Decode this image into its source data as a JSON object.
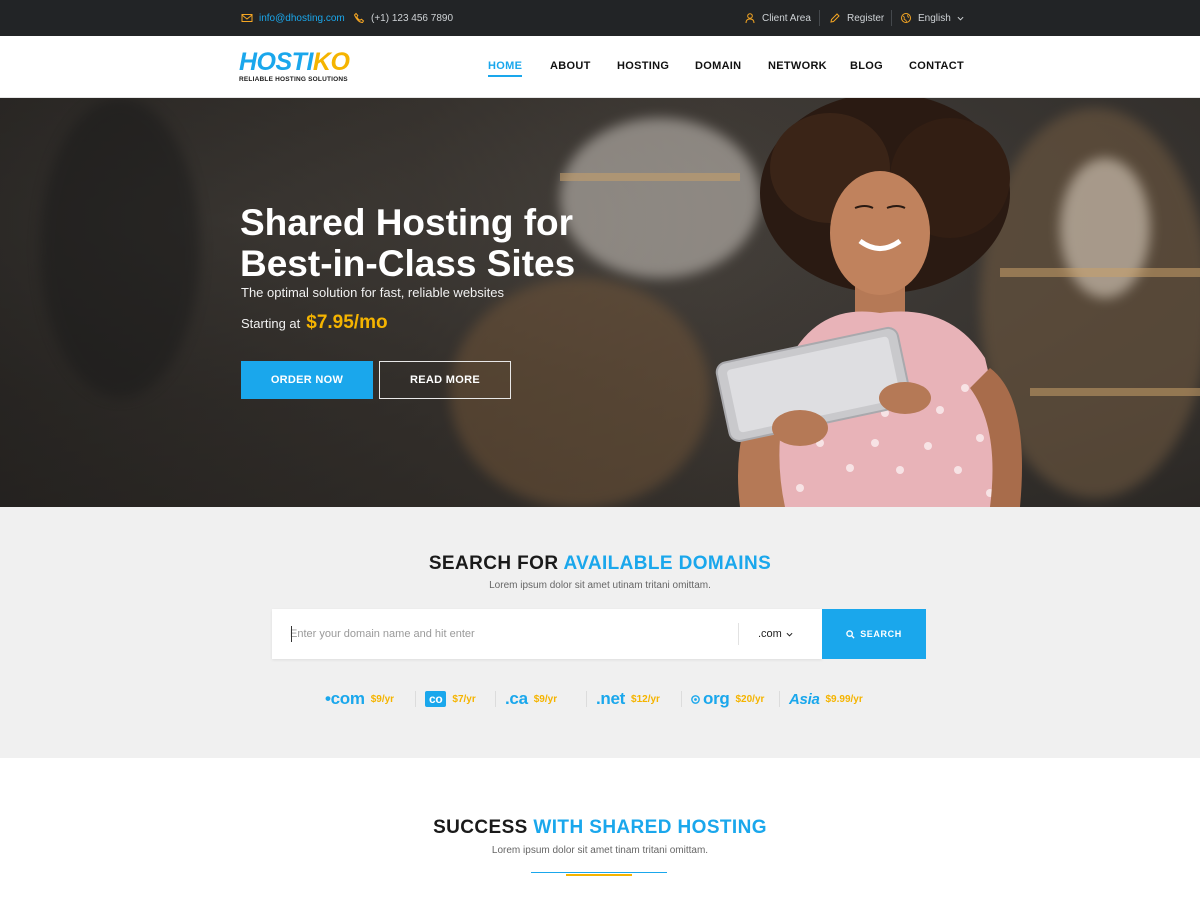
{
  "topbar": {
    "email": "info@dhosting.com",
    "phone": "(+1) 123 456 7890",
    "client_area": "Client Area",
    "register": "Register",
    "language": "English"
  },
  "header": {
    "logo_part1": "HOSTI",
    "logo_part2": "KO",
    "logo_tagline": "RELIABLE HOSTING SOLUTIONS",
    "nav": [
      {
        "label": "HOME",
        "active": true
      },
      {
        "label": "ABOUT"
      },
      {
        "label": "HOSTING"
      },
      {
        "label": "DOMAIN"
      },
      {
        "label": "NETWORK"
      },
      {
        "label": "BLOG"
      },
      {
        "label": "CONTACT"
      }
    ]
  },
  "hero": {
    "title_line1": "Shared Hosting for",
    "title_line2": "Best-in-Class Sites",
    "subtitle": "The optimal solution for fast, reliable websites",
    "starting_label": "Starting at",
    "price": "$7.95/mo",
    "order_button": "ORDER NOW",
    "read_button": "READ MORE"
  },
  "domain_search": {
    "title_part1": "SEARCH FOR",
    "title_part2": "AVAILABLE DOMAINS",
    "subtitle": "Lorem ipsum dolor sit amet utinam tritani omittam.",
    "placeholder": "Enter your domain name and hit enter",
    "tld_selected": ".com",
    "search_button": "SEARCH",
    "tlds": [
      {
        "name": "•com",
        "price": "$9/yr"
      },
      {
        "name": "co",
        "price": "$7/yr"
      },
      {
        "name": ".ca",
        "price": "$9/yr"
      },
      {
        "name": ".net",
        "price": "$12/yr"
      },
      {
        "name": "org",
        "price": "$20/yr"
      },
      {
        "name": "Asia",
        "price": "$9.99/yr"
      }
    ]
  },
  "success": {
    "title_part1": "SUCCESS",
    "title_part2": "WITH SHARED HOSTING",
    "subtitle": "Lorem ipsum dolor sit amet tinam tritani omittam."
  },
  "colors": {
    "accent_blue": "#1aa7ec",
    "accent_yellow": "#f5b400",
    "topbar_bg": "#222426"
  }
}
